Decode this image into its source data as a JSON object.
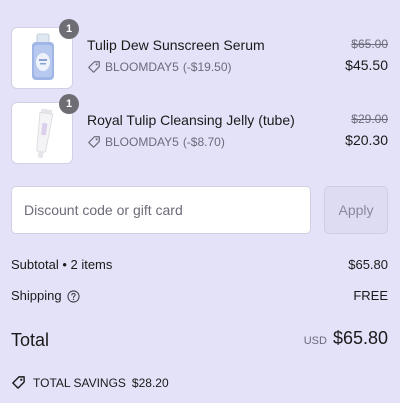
{
  "items": [
    {
      "name": "Tulip Dew Sunscreen Serum",
      "quantity": "1",
      "discount_code": "BLOOMDAY5",
      "discount_amount": "(-$19.50)",
      "compare_price": "$65.00",
      "price": "$45.50",
      "thumbnail_icon": "serum-bottle-icon"
    },
    {
      "name": "Royal Tulip Cleansing Jelly (tube)",
      "quantity": "1",
      "discount_code": "BLOOMDAY5",
      "discount_amount": "(-$8.70)",
      "compare_price": "$29.00",
      "price": "$20.30",
      "thumbnail_icon": "tube-icon"
    }
  ],
  "discount": {
    "placeholder": "Discount code or gift card",
    "apply_label": "Apply"
  },
  "summary": {
    "subtotal_label": "Subtotal • 2 items",
    "subtotal_value": "$65.80",
    "shipping_label": "Shipping",
    "shipping_value": "FREE",
    "total_label": "Total",
    "currency": "USD",
    "total_value": "$65.80",
    "savings_label": "TOTAL SAVINGS",
    "savings_value": "$28.20"
  },
  "colors": {
    "background": "#e4e2f8",
    "badge": "#6d6d73",
    "muted_text": "#6b6b7a",
    "apply_button_bg": "#dedcf2"
  }
}
